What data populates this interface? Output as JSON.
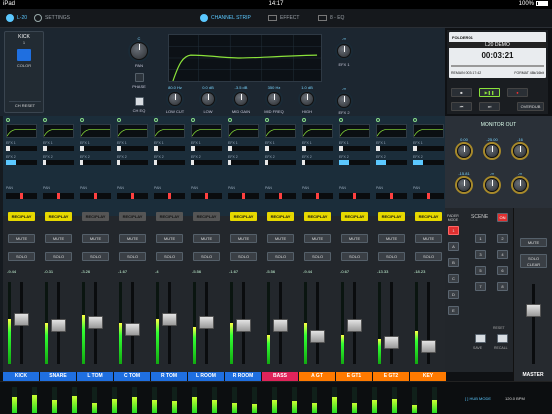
{
  "statusbar": {
    "device": "iPad",
    "time": "14:17",
    "battery": "100%"
  },
  "nav": {
    "app": "L-20",
    "settings": "SETTINGS",
    "channel_strip": "CHANNEL STRIP",
    "effect": "EFFECT",
    "eq": "8 - EQ"
  },
  "channel": {
    "name": "KICK",
    "number": "1",
    "color_label": "COLOR",
    "reset_label": "CH RESET",
    "color": "#1f6fe0"
  },
  "knobs": {
    "pan": "PAN",
    "phase": "PHASE",
    "ch_eq": "CH EQ",
    "low_cut": "LOW CUT",
    "low": "LOW",
    "mid_gain": "MID GAIN",
    "mid_freq": "MID FREQ",
    "high": "HIGH",
    "efx1": "EFX 1",
    "efx2": "EFX 2",
    "low_cut_val": "80.0 Hz",
    "low_val": "0.0 dB",
    "mid_gain_val": "-3.5 dB",
    "mid_freq_val": "350 Hz",
    "high_val": "1.0 dB",
    "pan_val": "C",
    "efx1_val": "-∞",
    "efx2_val": "-∞"
  },
  "recorder": {
    "folder": "FOLDER01",
    "song": "L20 DEMO",
    "time": "00:03:21",
    "remain": "REMAIN 003:17:42",
    "format": "FORMAT 48k/16bit",
    "overdub": "OVERDUB"
  },
  "strip_labels": {
    "efx1": "EFX 1",
    "efx2": "EFX 2",
    "pan": "PAN",
    "recplay": "REC/PLAY",
    "mute": "MUTE",
    "solo": "SOLO"
  },
  "strips": [
    {
      "name": "KICK",
      "db": "-9.44",
      "color": "#1f6fe0"
    },
    {
      "name": "SNARE",
      "db": "-0.31",
      "color": "#1f6fe0"
    },
    {
      "name": "L TOM",
      "db": "-3.26",
      "color": "#1f6fe0"
    },
    {
      "name": "C TOM",
      "db": "-1.67",
      "color": "#1f6fe0"
    },
    {
      "name": "R TOM",
      "db": "-4",
      "color": "#1f6fe0"
    },
    {
      "name": "L ROOM",
      "db": "-5.56",
      "color": "#1f6fe0"
    },
    {
      "name": "R ROOM",
      "db": "-1.67",
      "color": "#1f6fe0"
    },
    {
      "name": "BASS",
      "db": "-5.56",
      "color": "#e0245a"
    },
    {
      "name": "A GT",
      "db": "-9.44",
      "color": "#ff7a00"
    },
    {
      "name": "E GT1",
      "db": "-0.67",
      "color": "#ff7a00"
    },
    {
      "name": "E GT2",
      "db": "-13.33",
      "color": "#ff7a00"
    },
    {
      "name": "KEY",
      "db": "-18.23",
      "color": "#ff7a00"
    }
  ],
  "monitor": {
    "title": "MONITOR OUT",
    "vals": [
      "0.00",
      "-25.00",
      "-16",
      "-15.81",
      "-∞",
      "-∞"
    ]
  },
  "fader_mode": {
    "title": "FADER MODE",
    "scene": "SCENE",
    "on": "ON",
    "reset": "RESET",
    "save": "SAVE",
    "recall": "RECALL",
    "scene_nums": [
      "1",
      "2",
      "3",
      "4",
      "5",
      "6",
      "7",
      "8"
    ]
  },
  "master": {
    "label": "MASTER",
    "solo_clear": "SOLO CLEAR"
  },
  "bottom": {
    "hub": "HUB MODE",
    "bpm": "120.0 BPM"
  }
}
